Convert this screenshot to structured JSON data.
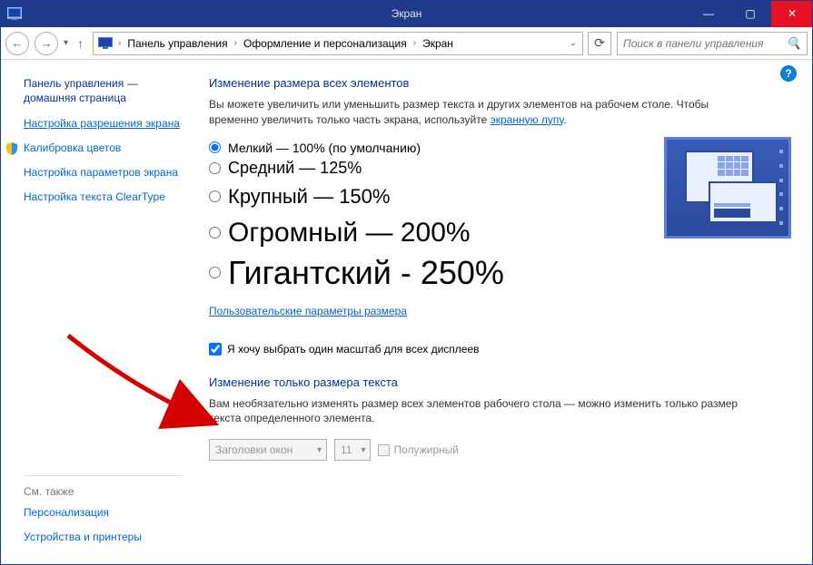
{
  "window": {
    "title": "Экран"
  },
  "breadcrumb": {
    "items": [
      "Панель управления",
      "Оформление и персонализация",
      "Экран"
    ]
  },
  "search": {
    "placeholder": "Поиск в панели управления"
  },
  "sidebar": {
    "header": "Панель управления — домашняя страница",
    "links": [
      {
        "label": "Настройка разрешения экрана",
        "active": true
      },
      {
        "label": "Калибровка цветов",
        "shield": true
      },
      {
        "label": "Настройка параметров экрана"
      },
      {
        "label": "Настройка текста ClearType"
      }
    ],
    "footer_header": "См. также",
    "footer_links": [
      {
        "label": "Персонализация"
      },
      {
        "label": "Устройства и принтеры"
      }
    ]
  },
  "main": {
    "section1_title": "Изменение размера всех элементов",
    "section1_desc_a": "Вы можете увеличить или уменьшить размер текста и других элементов на рабочем столе. Чтобы временно увеличить только часть экрана, используйте ",
    "section1_link": "экранную лупу",
    "section1_desc_b": ".",
    "sizes": [
      {
        "label": "Мелкий — 100% (по умолчанию)",
        "checked": true
      },
      {
        "label": "Средний — 125%"
      },
      {
        "label": "Крупный — 150%"
      },
      {
        "label": "Огромный — 200%"
      },
      {
        "label": "Гигантский - 250%"
      }
    ],
    "custom_link": "Пользовательские параметры размера",
    "checkbox_label": "Я хочу выбрать один масштаб для всех дисплеев",
    "section2_title": "Изменение только размера текста",
    "section2_desc": "Вам необязательно изменять размер всех элементов рабочего стола — можно изменить только размер текста определенного элемента.",
    "combo_element": "Заголовки окон",
    "combo_size": "11",
    "bold_label": "Полужирный"
  }
}
